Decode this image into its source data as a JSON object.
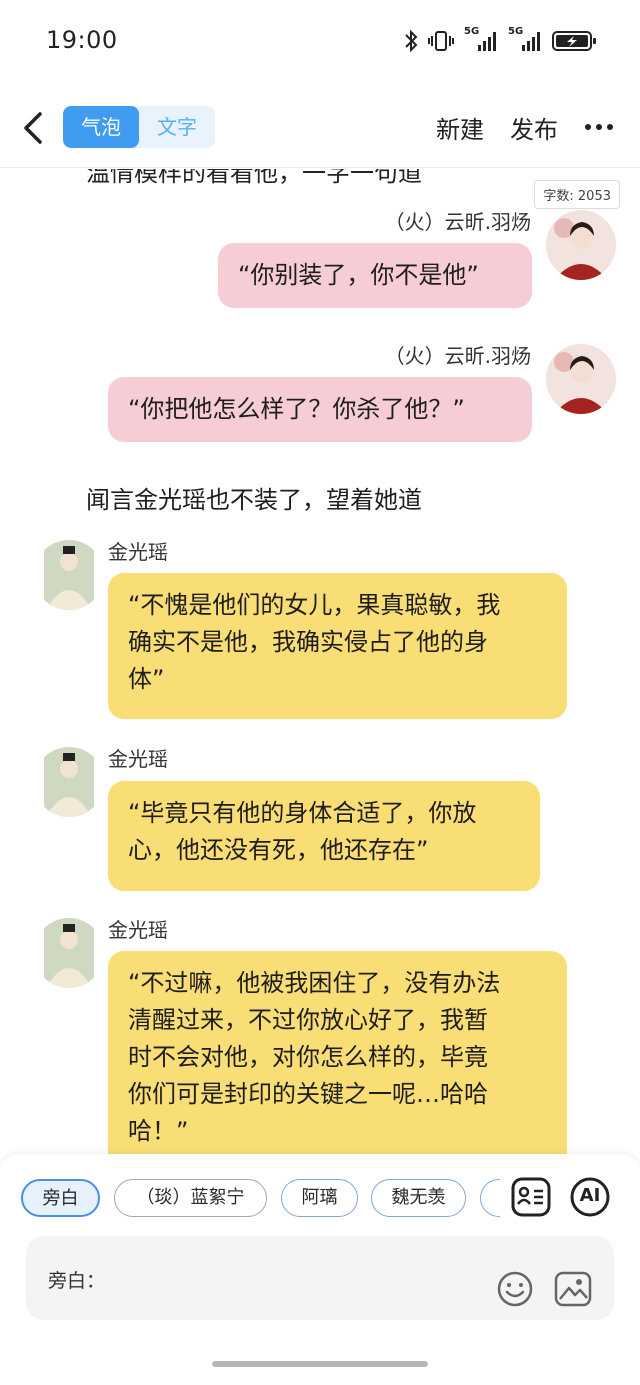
{
  "status_bar": {
    "time": "19:00",
    "net1": "5G",
    "net2": "5G"
  },
  "header": {
    "back_icon": "chevron-left-icon",
    "mode_tabs": [
      {
        "label": "气泡",
        "active": true
      },
      {
        "label": "文字",
        "active": false
      }
    ],
    "new_label": "新建",
    "publish_label": "发布",
    "more_icon": "more-dots-icon"
  },
  "chat": {
    "partial_text": "温情模样的看看他，一字一句道",
    "word_count": "字数: 2053",
    "messages": [
      {
        "side": "right",
        "sender": "（火）云昕.羽炀",
        "text": "“你别装了，你不是他”"
      },
      {
        "side": "right",
        "sender": "（火）云昕.羽炀",
        "text": "“你把他怎么样了？你杀了他？”"
      },
      {
        "side": "narration",
        "text": "闻言金光瑶也不装了，望着她道"
      },
      {
        "side": "left",
        "sender": "金光瑶",
        "lines": [
          "“不愧是他们的女儿，果真聪敏，我",
          "确实不是他，我确实侵占了他的身",
          "体”"
        ]
      },
      {
        "side": "left",
        "sender": "金光瑶",
        "lines": [
          "“毕竟只有他的身体合适了，你放",
          "心，他还没有死，他还存在”"
        ]
      },
      {
        "side": "left",
        "sender": "金光瑶",
        "lines": [
          "“不过嘛，他被我困住了，没有办法",
          "清醒过来，不过你放心好了，我暂",
          "时不会对他，对你怎么样的，毕竟",
          "你们可是封印的关键之一呢…哈哈",
          "哈！”"
        ]
      }
    ]
  },
  "composer": {
    "chips": [
      "旁白",
      "（琰）蓝絮宁",
      "阿璃",
      "魏无羡"
    ],
    "input_label": "旁白：",
    "ai_label": "AI",
    "colors": {
      "accent": "#3f9cf0",
      "pink_bubble": "#f6cdd5",
      "yellow_bubble": "#f9dd75"
    }
  }
}
